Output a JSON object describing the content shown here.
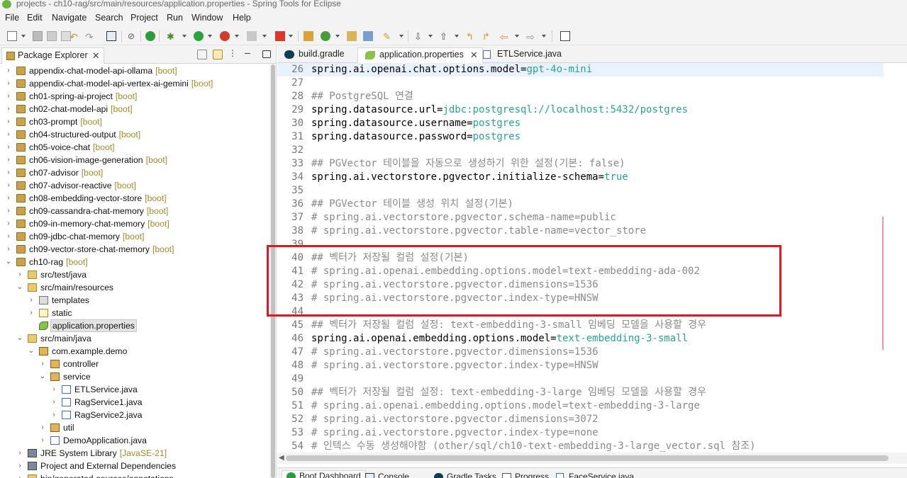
{
  "window": {
    "title": "projects - ch10-rag/src/main/resources/application.properties - Spring Tools for Eclipse"
  },
  "menu": [
    "File",
    "Edit",
    "Navigate",
    "Search",
    "Project",
    "Run",
    "Window",
    "Help"
  ],
  "package_explorer": {
    "tab_label": "Package Explorer",
    "close_glyph": "✕",
    "rows": [
      {
        "label": "appendix-chat-model-api-ollama",
        "tag": "[boot]"
      },
      {
        "label": "appendix-chat-model-api-vertex-ai-gemini",
        "tag": "[boot]"
      },
      {
        "label": "ch01-spring-ai-project",
        "tag": "[boot]"
      },
      {
        "label": "ch02-chat-model-api",
        "tag": "[boot]"
      },
      {
        "label": "ch03-prompt",
        "tag": "[boot]"
      },
      {
        "label": "ch04-structured-output",
        "tag": "[boot]"
      },
      {
        "label": "ch05-voice-chat",
        "tag": "[boot]"
      },
      {
        "label": "ch06-vision-image-generation",
        "tag": "[boot]"
      },
      {
        "label": "ch07-advisor",
        "tag": "[boot]"
      },
      {
        "label": "ch07-advisor-reactive",
        "tag": "[boot]"
      },
      {
        "label": "ch08-embedding-vector-store",
        "tag": "[boot]"
      },
      {
        "label": "ch09-cassandra-chat-memory",
        "tag": "[boot]"
      },
      {
        "label": "ch09-in-memory-chat-memory",
        "tag": "[boot]"
      },
      {
        "label": "ch09-jdbc-chat-memory",
        "tag": "[boot]"
      },
      {
        "label": "ch09-vector-store-chat-memory",
        "tag": "[boot]"
      },
      {
        "label": "ch10-rag",
        "tag": "[boot]"
      },
      {
        "label": "src/test/java",
        "tag": ""
      },
      {
        "label": "src/main/resources",
        "tag": ""
      },
      {
        "label": "templates",
        "tag": ""
      },
      {
        "label": "static",
        "tag": ""
      },
      {
        "label": "application.properties",
        "tag": ""
      },
      {
        "label": "src/main/java",
        "tag": ""
      },
      {
        "label": "com.example.demo",
        "tag": ""
      },
      {
        "label": "controller",
        "tag": ""
      },
      {
        "label": "service",
        "tag": ""
      },
      {
        "label": "ETLService.java",
        "tag": ""
      },
      {
        "label": "RagService1.java",
        "tag": ""
      },
      {
        "label": "RagService2.java",
        "tag": ""
      },
      {
        "label": "util",
        "tag": ""
      },
      {
        "label": "DemoApplication.java",
        "tag": ""
      },
      {
        "label": "JRE System Library",
        "tag": "[JavaSE-21]"
      },
      {
        "label": "Project and External Dependencies",
        "tag": ""
      },
      {
        "label": "bin/generated-sources/annotations",
        "tag": ""
      }
    ]
  },
  "editor": {
    "tabs": [
      {
        "label": "build.gradle"
      },
      {
        "label": "application.properties",
        "close": "✕"
      },
      {
        "label": "ETLService.java"
      }
    ],
    "lines": [
      {
        "num": "26",
        "key": "spring.ai.openai.chat.options.model=",
        "value": "gpt-4o-mini",
        "comment": ""
      },
      {
        "num": "27",
        "key": "",
        "value": "",
        "comment": ""
      },
      {
        "num": "28",
        "key": "",
        "value": "",
        "comment": "## PostgreSQL 연결"
      },
      {
        "num": "29",
        "key": "spring.datasource.url=",
        "value": "jdbc:postgresql://localhost:5432/postgres",
        "comment": ""
      },
      {
        "num": "30",
        "key": "spring.datasource.username=",
        "value": "postgres",
        "comment": ""
      },
      {
        "num": "31",
        "key": "spring.datasource.password=",
        "value": "postgres",
        "comment": ""
      },
      {
        "num": "32",
        "key": "",
        "value": "",
        "comment": ""
      },
      {
        "num": "33",
        "key": "",
        "value": "",
        "comment": "## PGVector 테이블을 자동으로 생성하기 위한 설정(기본: false)"
      },
      {
        "num": "34",
        "key": "spring.ai.vectorstore.pgvector.initialize-schema=",
        "value": "true",
        "comment": ""
      },
      {
        "num": "35",
        "key": "",
        "value": "",
        "comment": ""
      },
      {
        "num": "36",
        "key": "",
        "value": "",
        "comment": "## PGVector 테이블 생성 위치 설정(기본)"
      },
      {
        "num": "37",
        "key": "",
        "value": "",
        "comment": "# spring.ai.vectorstore.pgvector.schema-name=public"
      },
      {
        "num": "38",
        "key": "",
        "value": "",
        "comment": "# spring.ai.vectorstore.pgvector.table-name=vector_store"
      },
      {
        "num": "39",
        "key": "",
        "value": "",
        "comment": ""
      },
      {
        "num": "40",
        "key": "",
        "value": "",
        "comment": "## 벡터가 저장될 컬럼 설정(기본)"
      },
      {
        "num": "41",
        "key": "",
        "value": "",
        "comment": "# spring.ai.openai.embedding.options.model=text-embedding-ada-002"
      },
      {
        "num": "42",
        "key": "",
        "value": "",
        "comment": "# spring.ai.vectorstore.pgvector.dimensions=1536"
      },
      {
        "num": "43",
        "key": "",
        "value": "",
        "comment": "# spring.ai.vectorstore.pgvector.index-type=HNSW"
      },
      {
        "num": "44",
        "key": "",
        "value": "",
        "comment": ""
      },
      {
        "num": "45",
        "key": "",
        "value": "",
        "comment": "## 벡터가 저장될 컬럼 설정: text-embedding-3-small 임베딩 모델을 사용할 경우"
      },
      {
        "num": "46",
        "key": "spring.ai.openai.embedding.options.model=",
        "value": "text-embedding-3-small",
        "comment": ""
      },
      {
        "num": "47",
        "key": "",
        "value": "",
        "comment": "# spring.ai.vectorstore.pgvector.dimensions=1536"
      },
      {
        "num": "48",
        "key": "",
        "value": "",
        "comment": "# spring.ai.vectorstore.pgvector.index-type=HNSW"
      },
      {
        "num": "49",
        "key": "",
        "value": "",
        "comment": ""
      },
      {
        "num": "50",
        "key": "",
        "value": "",
        "comment": "## 벡터가 저장될 컬럼 설정: text-embedding-3-large 임베딩 모델을 사용할 경우"
      },
      {
        "num": "51",
        "key": "",
        "value": "",
        "comment": "# spring.ai.openai.embedding.options.model=text-embedding-3-large"
      },
      {
        "num": "52",
        "key": "",
        "value": "",
        "comment": "# spring.ai.vectorstore.pgvector.dimensions=3072"
      },
      {
        "num": "53",
        "key": "",
        "value": "",
        "comment": "# spring.ai.vectorstore.pgvector.index-type=none"
      },
      {
        "num": "54",
        "key": "",
        "value": "",
        "comment": "# 인텍스 수동 생성해야함 (other/sql/ch10-text-embedding-3-large_vector.sql 참조)"
      }
    ]
  },
  "bottom_tabs": [
    "Boot Dashboard",
    "Console",
    "Gradle Tasks",
    "Progress",
    "FaceService.java"
  ],
  "colors": {
    "highlight_box": "#e5141e",
    "value_text": "#2aa198",
    "comment_text": "#8a8a8a"
  }
}
